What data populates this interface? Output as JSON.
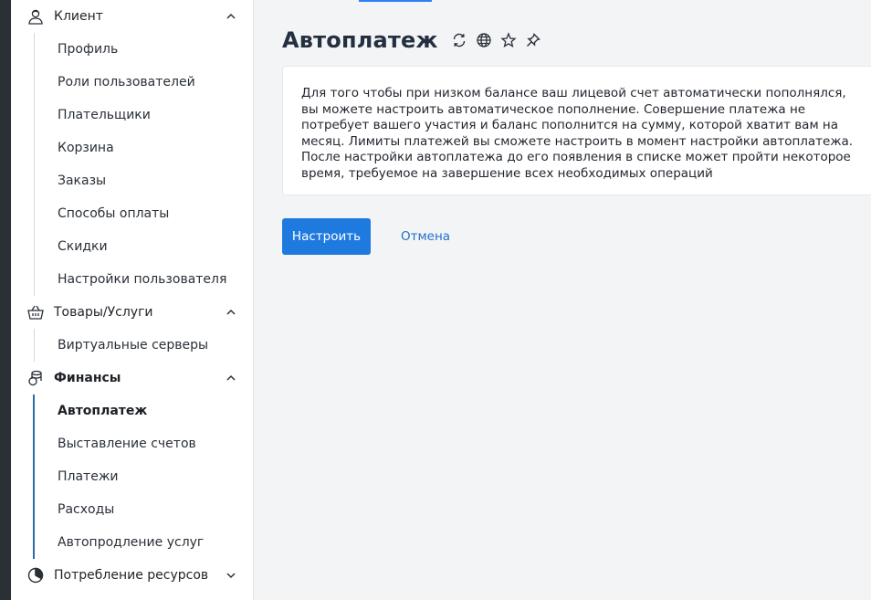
{
  "sidebar": {
    "groups": [
      {
        "label": "Клиент",
        "icon": "user-icon",
        "expanded": true,
        "items": [
          "Профиль",
          "Роли пользователей",
          "Плательщики",
          "Корзина",
          "Заказы",
          "Способы оплаты",
          "Скидки",
          "Настройки пользователя"
        ]
      },
      {
        "label": "Товары/Услуги",
        "icon": "basket-icon",
        "expanded": true,
        "items": [
          "Виртуальные серверы"
        ]
      },
      {
        "label": "Финансы",
        "icon": "coins-icon",
        "expanded": true,
        "items": [
          "Автоплатеж",
          "Выставление счетов",
          "Платежи",
          "Расходы",
          "Автопродление услуг"
        ],
        "active_item": "Автоплатеж"
      },
      {
        "label": "Потребление ресурсов",
        "icon": "pie-chart-icon",
        "expanded": false,
        "items": []
      }
    ]
  },
  "main": {
    "title": "Автоплатеж",
    "title_icons": [
      "refresh-icon",
      "globe-icon",
      "star-icon",
      "pin-icon"
    ],
    "info_lines": [
      "Для того чтобы при низком балансе ваш лицевой счет автоматически пополнялся, вы можете настроить автоматическое пополнение. Совершение платежа не потребует вашего участия и баланс пополнится на сумму, которой хватит вам на месяц. Лимиты платежей вы сможете настроить в момент настройки автоплатежа.",
      "После настройки автоплатежа до его появления в списке может пройти некоторое время, требуемое на завершение всех необходимых операций"
    ],
    "configure_button": "Настроить",
    "cancel_button": "Отмена"
  },
  "colors": {
    "accent": "#1f7ae0",
    "link": "#2370c8",
    "active_bar": "#2e6ca4",
    "background": "#f3f4f6"
  }
}
